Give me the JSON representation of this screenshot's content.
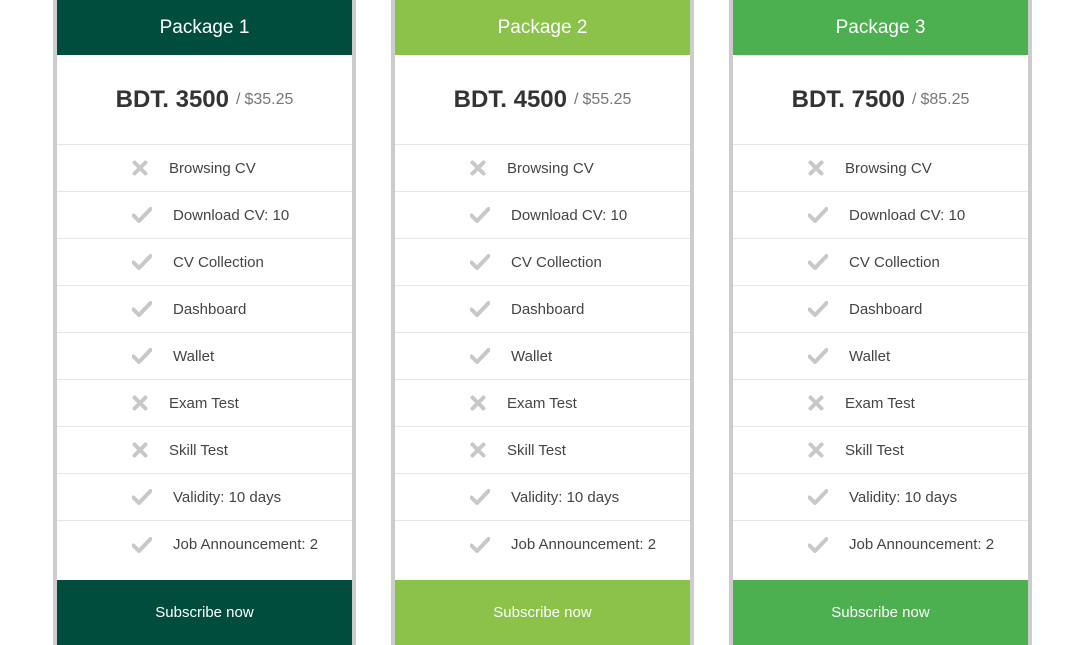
{
  "colors": {
    "package1": "#004d3d",
    "package2": "#8bc34a",
    "package3": "#4caf50",
    "border": "#cccccc",
    "icon": "#c8c8c8"
  },
  "packages": [
    {
      "title": "Package 1",
      "price_bdt": "BDT. 3500",
      "separator": "/",
      "price_usd": "$35.25",
      "subscribe_label": "Subscribe now",
      "features": [
        {
          "label": "Browsing CV",
          "included": false,
          "icon": "cross-icon"
        },
        {
          "label": "Download CV: 10",
          "included": true,
          "icon": "check-icon"
        },
        {
          "label": "CV Collection",
          "included": true,
          "icon": "check-icon"
        },
        {
          "label": "Dashboard",
          "included": true,
          "icon": "check-icon"
        },
        {
          "label": "Wallet",
          "included": true,
          "icon": "check-icon"
        },
        {
          "label": "Exam Test",
          "included": false,
          "icon": "cross-icon"
        },
        {
          "label": "Skill Test",
          "included": false,
          "icon": "cross-icon"
        },
        {
          "label": "Validity: 10 days",
          "included": true,
          "icon": "check-icon"
        },
        {
          "label": "Job Announcement: 2",
          "included": true,
          "icon": "check-icon"
        }
      ]
    },
    {
      "title": "Package 2",
      "price_bdt": "BDT. 4500",
      "separator": "/",
      "price_usd": "$55.25",
      "subscribe_label": "Subscribe now",
      "features": [
        {
          "label": "Browsing CV",
          "included": false,
          "icon": "cross-icon"
        },
        {
          "label": "Download CV: 10",
          "included": true,
          "icon": "check-icon"
        },
        {
          "label": "CV Collection",
          "included": true,
          "icon": "check-icon"
        },
        {
          "label": "Dashboard",
          "included": true,
          "icon": "check-icon"
        },
        {
          "label": "Wallet",
          "included": true,
          "icon": "check-icon"
        },
        {
          "label": "Exam Test",
          "included": false,
          "icon": "cross-icon"
        },
        {
          "label": "Skill Test",
          "included": false,
          "icon": "cross-icon"
        },
        {
          "label": "Validity: 10 days",
          "included": true,
          "icon": "check-icon"
        },
        {
          "label": "Job Announcement: 2",
          "included": true,
          "icon": "check-icon"
        }
      ]
    },
    {
      "title": "Package 3",
      "price_bdt": "BDT. 7500",
      "separator": "/",
      "price_usd": "$85.25",
      "subscribe_label": "Subscribe now",
      "features": [
        {
          "label": "Browsing CV",
          "included": false,
          "icon": "cross-icon"
        },
        {
          "label": "Download CV: 10",
          "included": true,
          "icon": "check-icon"
        },
        {
          "label": "CV Collection",
          "included": true,
          "icon": "check-icon"
        },
        {
          "label": "Dashboard",
          "included": true,
          "icon": "check-icon"
        },
        {
          "label": "Wallet",
          "included": true,
          "icon": "check-icon"
        },
        {
          "label": "Exam Test",
          "included": false,
          "icon": "cross-icon"
        },
        {
          "label": "Skill Test",
          "included": false,
          "icon": "cross-icon"
        },
        {
          "label": "Validity: 10 days",
          "included": true,
          "icon": "check-icon"
        },
        {
          "label": "Job Announcement: 2",
          "included": true,
          "icon": "check-icon"
        }
      ]
    }
  ]
}
